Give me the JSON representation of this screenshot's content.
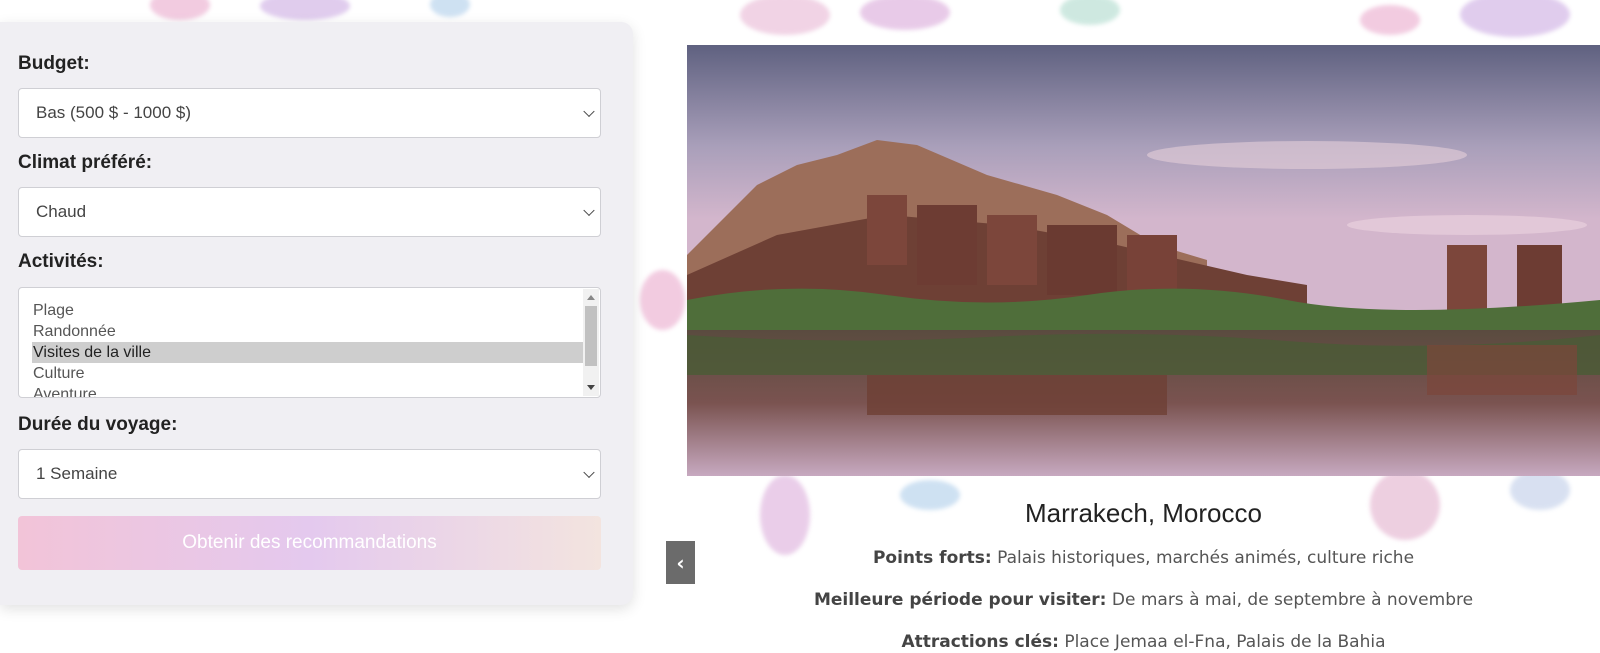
{
  "filters": {
    "budget": {
      "label": "Budget:",
      "value": "Bas (500 $ - 1000 $)"
    },
    "climate": {
      "label": "Climat préféré:",
      "value": "Chaud"
    },
    "activities": {
      "label": "Activités:",
      "options": [
        "Plage",
        "Randonnée",
        "Visites de la ville",
        "Culture",
        "Aventure"
      ],
      "selected": "Visites de la ville"
    },
    "duration": {
      "label": "Durée du voyage:",
      "value": "1 Semaine"
    },
    "submit_label": "Obtenir des recommandations"
  },
  "destination": {
    "title": "Marrakech, Morocco",
    "highlights": {
      "label": "Points forts:",
      "value": "Palais historiques, marchés animés, culture riche"
    },
    "best_period": {
      "label": "Meilleure période pour visiter:",
      "value": "De mars à mai, de septembre à novembre"
    },
    "attractions": {
      "label": "Attractions clés:",
      "value": "Place Jemaa el-Fna, Palais de la Bahia"
    }
  },
  "carousel": {
    "prev_icon": "‹"
  },
  "colors": {
    "panel_bg": "#f0eff3",
    "cta_gradient": [
      "#f2c4d8",
      "#e4c9ee",
      "#f3e4df"
    ],
    "nav_button": "#6b6b6b"
  }
}
